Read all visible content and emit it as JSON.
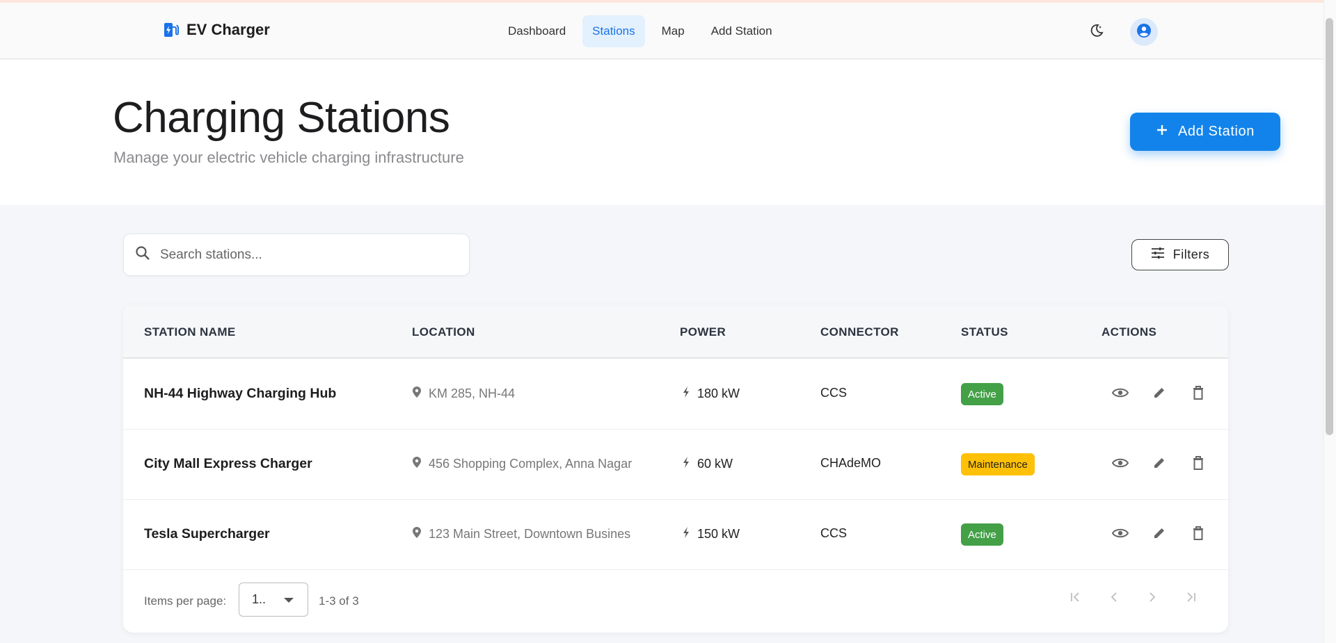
{
  "app": {
    "name": "EV Charger",
    "nav": [
      {
        "label": "Dashboard",
        "active": false
      },
      {
        "label": "Stations",
        "active": true
      },
      {
        "label": "Map",
        "active": false
      },
      {
        "label": "Add Station",
        "active": false
      }
    ],
    "icons": {
      "logo": "ev-station-icon",
      "theme": "moon-icon",
      "account": "account-circle-icon"
    }
  },
  "page": {
    "title": "Charging Stations",
    "subtitle": "Manage your electric vehicle charging infrastructure",
    "add_button": "Add Station"
  },
  "search": {
    "placeholder": "Search stations...",
    "value": ""
  },
  "filters": {
    "label": "Filters"
  },
  "table": {
    "headers": [
      "STATION NAME",
      "LOCATION",
      "POWER",
      "CONNECTOR",
      "STATUS",
      "ACTIONS"
    ],
    "rows": [
      {
        "name": "NH-44 Highway Charging Hub",
        "location": "KM 285, NH-44",
        "power": "180 kW",
        "connector": "CCS",
        "status": "Active"
      },
      {
        "name": "City Mall Express Charger",
        "location": "456 Shopping Complex, Anna Nagar",
        "power": "60 kW",
        "connector": "CHAdeMO",
        "status": "Maintenance"
      },
      {
        "name": "Tesla Supercharger",
        "location": "123 Main Street, Downtown Busines",
        "power": "150 kW",
        "connector": "CCS",
        "status": "Active"
      }
    ]
  },
  "pagination": {
    "items_per_page_label": "Items per page:",
    "items_per_page_value": "1..",
    "range": "1-3 of 3"
  },
  "colors": {
    "primary": "#1283ea",
    "active": "#43a047",
    "maintenance": "#ffc107",
    "nav_active_bg": "#e3f0fd"
  }
}
